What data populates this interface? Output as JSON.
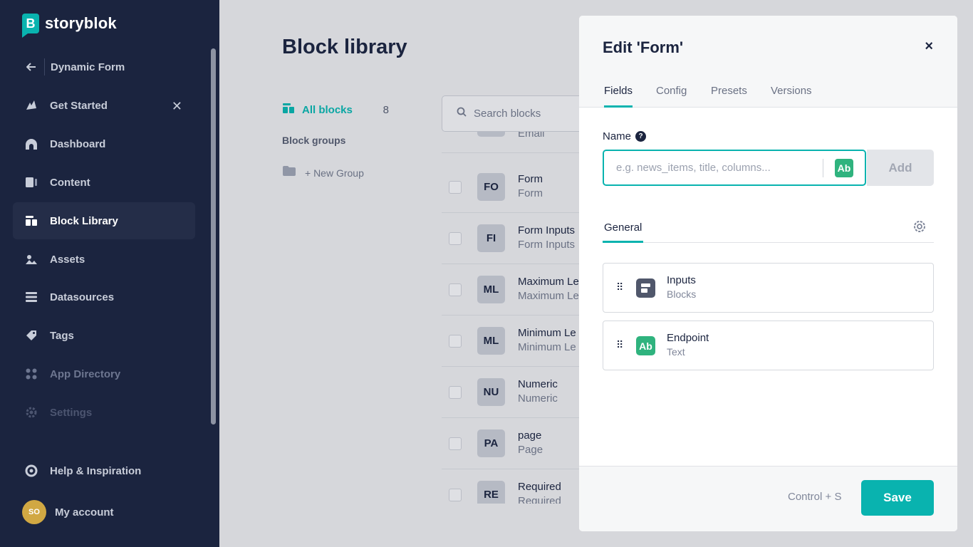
{
  "sidebar": {
    "brand": "storyblok",
    "logo_letter": "B",
    "back_label": "Dynamic Form",
    "items": [
      {
        "label": "Get Started",
        "icon": "rocket-hand-icon"
      },
      {
        "label": "Dashboard",
        "icon": "dashboard-icon"
      },
      {
        "label": "Content",
        "icon": "content-icon"
      },
      {
        "label": "Block Library",
        "icon": "block-library-icon"
      },
      {
        "label": "Assets",
        "icon": "assets-icon"
      },
      {
        "label": "Datasources",
        "icon": "datasources-icon"
      },
      {
        "label": "Tags",
        "icon": "tag-icon"
      },
      {
        "label": "App Directory",
        "icon": "app-directory-icon"
      },
      {
        "label": "Settings",
        "icon": "settings-icon"
      },
      {
        "label": "Help & Inspiration",
        "icon": "help-icon"
      }
    ],
    "account": {
      "initials": "SO",
      "label": "My account"
    }
  },
  "main": {
    "title": "Block library",
    "all_blocks_label": "All blocks",
    "all_blocks_count": "8",
    "block_groups_label": "Block groups",
    "new_group_label": "+ New Group",
    "search_placeholder": "Search blocks",
    "rows": [
      {
        "badge": "",
        "name": "",
        "subtitle": "Email"
      },
      {
        "badge": "FO",
        "name": "Form",
        "subtitle": "Form"
      },
      {
        "badge": "FI",
        "name": "Form Inputs",
        "subtitle": "Form Inputs"
      },
      {
        "badge": "ML",
        "name": "Maximum Le",
        "subtitle": "Maximum Le"
      },
      {
        "badge": "ML",
        "name": "Minimum Le",
        "subtitle": "Minimum Le"
      },
      {
        "badge": "NU",
        "name": "Numeric",
        "subtitle": "Numeric"
      },
      {
        "badge": "PA",
        "name": "page",
        "subtitle": "Page"
      },
      {
        "badge": "RE",
        "name": "Required",
        "subtitle": "Required"
      }
    ]
  },
  "modal": {
    "title": "Edit 'Form'",
    "close": "×",
    "tabs": [
      "Fields",
      "Config",
      "Presets",
      "Versions"
    ],
    "name_label": "Name",
    "help_glyph": "?",
    "name_placeholder": "e.g. news_items, title, columns...",
    "type_icon_label": "Ab",
    "add_label": "Add",
    "section_tab": "General",
    "fields": [
      {
        "name": "Inputs",
        "type": "Blocks",
        "icon": "blocks-icon",
        "icon_color": "#50576b"
      },
      {
        "name": "Endpoint",
        "type": "Text",
        "icon": "text-icon",
        "icon_label": "Ab",
        "icon_color": "#2fb37e"
      }
    ],
    "shortcut": "Control + S",
    "save_label": "Save"
  }
}
